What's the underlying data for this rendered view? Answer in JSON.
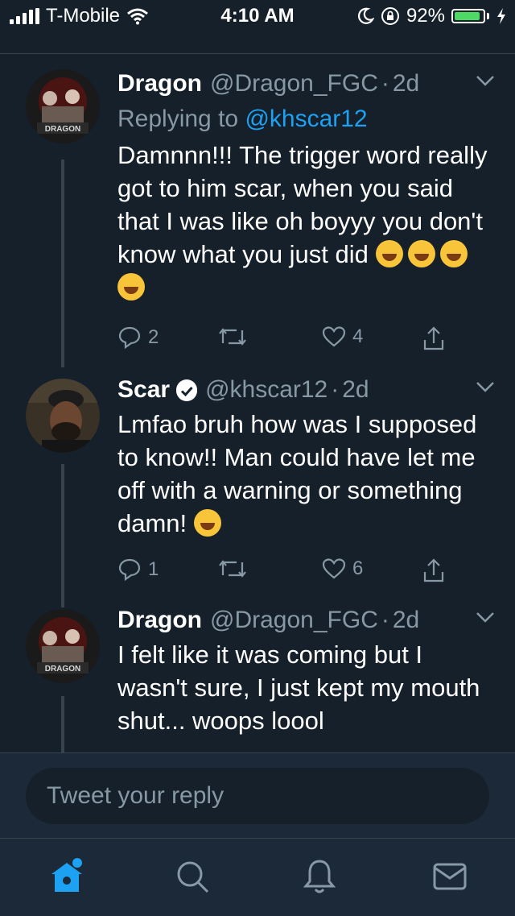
{
  "status_bar": {
    "carrier": "T-Mobile",
    "time": "4:10 AM",
    "battery_percent": "92%",
    "battery_level": 0.92
  },
  "tweets": [
    {
      "name": "Dragon",
      "handle": "@Dragon_FGC",
      "time": "2d",
      "replying_prefix": "Replying to",
      "replying_to": "@khscar12",
      "text": "Damnnn!!! The trigger word really got to him scar, when you said that I was like oh boyyy you don't know what you just did",
      "emoji_count": 4,
      "avatar_caption": "DRAGON",
      "replies": "2",
      "retweets": "",
      "likes": "4"
    },
    {
      "name": "Scar",
      "handle": "@khscar12",
      "time": "2d",
      "verified": true,
      "text": "Lmfao bruh how was I supposed to know!! Man could have let me off with a warning or something damn!",
      "emoji_count": 1,
      "replies": "1",
      "retweets": "",
      "likes": "6"
    },
    {
      "name": "Dragon",
      "handle": "@Dragon_FGC",
      "time": "2d",
      "text": "I felt like it was coming but I wasn't sure, I just kept my mouth shut... woops loool",
      "avatar_caption": "DRAGON"
    }
  ],
  "reply_box": {
    "placeholder": "Tweet your reply"
  },
  "tab_bar": {
    "items": [
      "home-icon",
      "search-icon",
      "notifications-icon",
      "messages-icon"
    ],
    "active": "home-icon"
  },
  "colors": {
    "background": "#15202b",
    "bar_background": "#1c2938",
    "accent": "#1da1f2",
    "secondary_text": "#8899a6",
    "battery": "#4cd964"
  }
}
